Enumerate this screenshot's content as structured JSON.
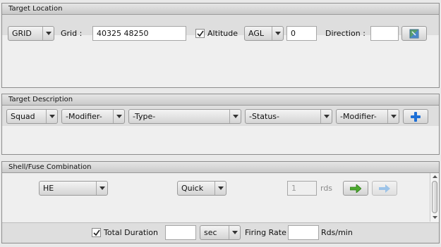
{
  "target_location": {
    "title": "Target Location",
    "coord_type": "GRID",
    "grid_label": "Grid :",
    "grid_value": "40325 48250",
    "altitude_checked": true,
    "altitude_label": "Altitude",
    "altitude_ref": "AGL",
    "altitude_value": "0",
    "direction_label": "Direction :",
    "direction_value": ""
  },
  "target_description": {
    "title": "Target Description",
    "size": "Squad",
    "modifier1": "-Modifier-",
    "type": "-Type-",
    "status": "-Status-",
    "modifier2": "-Modifier-"
  },
  "shell_fuse": {
    "title": "Shell/Fuse Combination",
    "shell": "HE",
    "fuse": "Quick",
    "rounds_value": "1",
    "rounds_label": "rds",
    "total_duration_checked": true,
    "total_duration_label": "Total Duration",
    "duration_value": "",
    "duration_unit": "sec",
    "firing_rate_label": "Firing Rate",
    "firing_rate_value": "",
    "firing_rate_unit": "Rds/min"
  },
  "icons": {
    "direction_button": "map-compass-icon",
    "add_description_button": "plus-icon",
    "add_combination_button": "green-arrow-icon",
    "next_combination_button": "blue-arrow-icon"
  },
  "colors": {
    "panel_bg": "#efefef",
    "plus_blue": "#1d6fd6",
    "arrow_green": "#4caa2e",
    "arrow_blue_disabled": "#9cc3e8"
  }
}
